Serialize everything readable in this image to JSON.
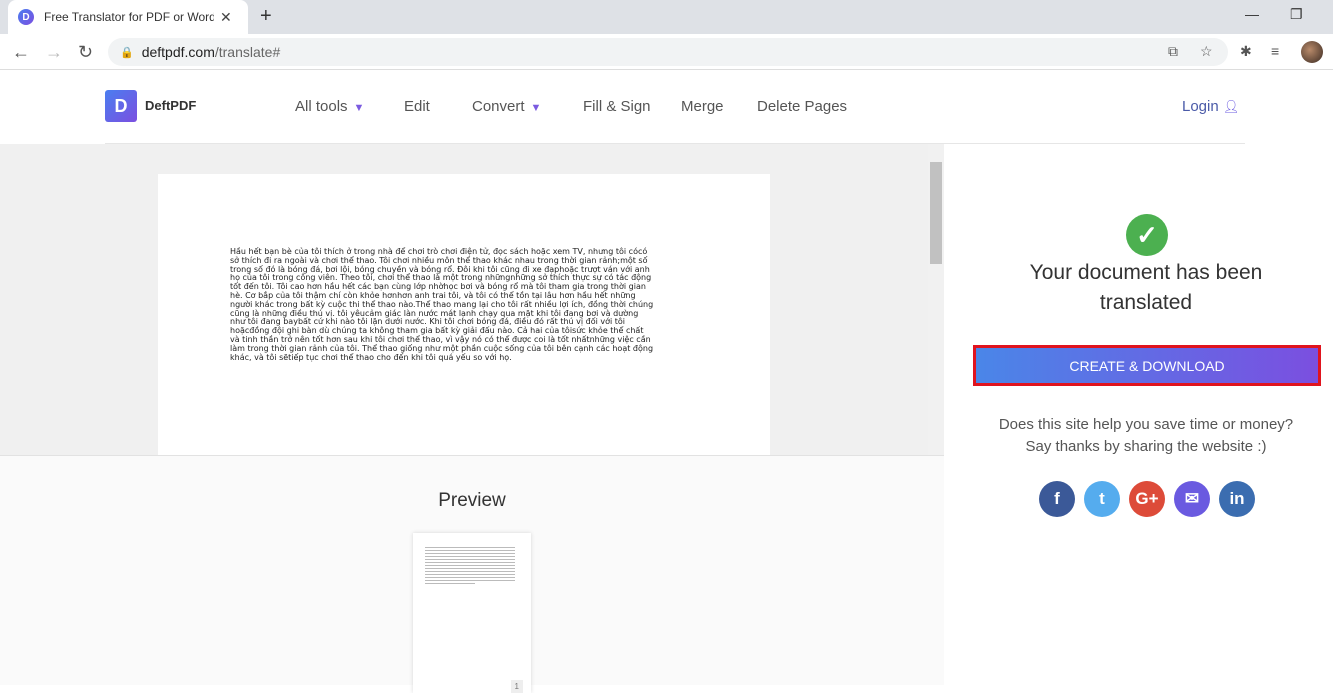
{
  "browser": {
    "tab_title": "Free Translator for PDF or Word u",
    "url_host": "deftpdf.com",
    "url_path": "/translate#",
    "favicon_letter": "D"
  },
  "site": {
    "logo_letter": "D",
    "brand": "DeftPDF",
    "menu": [
      {
        "label": "All tools",
        "dropdown": true
      },
      {
        "label": "Edit"
      },
      {
        "label": "Convert",
        "dropdown": true
      },
      {
        "label": "Fill & Sign"
      },
      {
        "label": "Merge"
      },
      {
        "label": "Delete Pages"
      }
    ],
    "login": "Login"
  },
  "document": {
    "lines": [
      "Hầu hết bạn bè của tôi thích ở trong nhà để chơi trò chơi điện tử, đọc sách hoặc xem TV, nhưng tôi cócó",
      "sở thích đi ra ngoài và chơi thể thao. Tôi chơi nhiều môn thể thao khác nhau trong thời gian rảnh;một số",
      "trong số đó là bóng đá, bơi lội, bóng chuyền và bóng rổ. Đôi khi tôi cũng đi xe đạphoặc trượt ván với anh",
      "họ của tôi trong công viên. Theo tôi, chơi thể thao là một trong nhữngnhững sở thích thực sự có tác động",
      "tốt đến tôi. Tôi cao hơn hầu hết các bạn cùng lớp nhờhọc bơi và bóng rổ mà tôi tham gia trong thời gian",
      "hè. Cơ bắp của tôi thậm chí còn khỏe hơnhơn anh trai tôi, và tôi có thể tồn tại lâu hơn hầu hết những",
      "người khác trong bất kỳ cuộc thi thể thao nào.Thể thao mang lại cho tôi rất nhiều lợi ích, đồng thời chúng",
      "cũng là những điều thú vị. tôi yêucảm giác làn nước mát lạnh chạy qua mặt khi tôi đang bơi và dường",
      "như tôi đang baybất cứ khi nào tôi lặn dưới nước. Khi tôi chơi bóng đá, điều đó rất thú vị đối với tôi",
      "hoặcđồng đội ghi bàn dù chúng ta không tham gia bất kỳ giải đấu nào. Cả hai của tôisức khỏe thể chất",
      "và tinh thần trở nên tốt hơn sau khi tôi chơi thể thao, vì vậy nó có thể được coi là tốt nhấtnhững việc cần",
      "làm trong thời gian rảnh của tôi. Thể thao giống như một phần cuộc sống của tôi bên cạnh các hoạt động",
      "khác, và tôi sẽtiếp tục chơi thể thao cho đến khi tôi quá yếu so với họ."
    ]
  },
  "preview": {
    "title": "Preview",
    "page_number": "1"
  },
  "result": {
    "title": "Your document has been translated",
    "button": "CREATE & DOWNLOAD",
    "share_line1": "Does this site help you save time or money?",
    "share_line2": "Say thanks by sharing the website :)",
    "socials": [
      {
        "name": "facebook",
        "glyph": "f",
        "color": "#3b5998"
      },
      {
        "name": "twitter",
        "glyph": "t",
        "color": "#55acee"
      },
      {
        "name": "google-plus",
        "glyph": "G+",
        "color": "#dd4b39"
      },
      {
        "name": "email",
        "glyph": "✉",
        "color": "#6a5ae0"
      },
      {
        "name": "linkedin",
        "glyph": "in",
        "color": "#3b6db0"
      }
    ]
  }
}
